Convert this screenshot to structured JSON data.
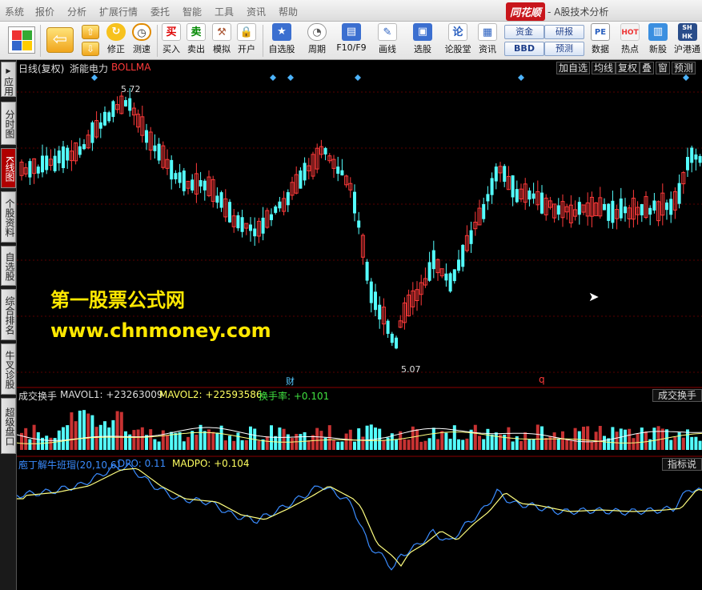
{
  "menubar": {
    "items": [
      "系统",
      "报价",
      "分析",
      "扩展行情",
      "委托",
      "智能",
      "工具",
      "资讯",
      "帮助"
    ],
    "brand": "同花顺",
    "subtitle": "- A股技术分析"
  },
  "toolbar": {
    "buttons": [
      {
        "label": "修正",
        "icon": "refresh-icon"
      },
      {
        "label": "测速",
        "icon": "clock-icon"
      },
      {
        "label": "买入",
        "icon": "buy-icon",
        "glyph": "买"
      },
      {
        "label": "卖出",
        "icon": "sell-icon",
        "glyph": "卖"
      },
      {
        "label": "模拟",
        "icon": "hammer-icon"
      },
      {
        "label": "开户",
        "icon": "lock-icon"
      },
      {
        "label": "自选股",
        "icon": "star-icon"
      },
      {
        "label": "周期",
        "icon": "period-icon"
      },
      {
        "label": "F10/F9",
        "icon": "f10-icon"
      },
      {
        "label": "画线",
        "icon": "pencil-icon"
      },
      {
        "label": "选股",
        "icon": "monitor-icon"
      },
      {
        "label": "论股堂",
        "icon": "discuss-icon"
      },
      {
        "label": "资讯",
        "icon": "news-icon"
      },
      {
        "label": "数据",
        "icon": "pe-icon"
      },
      {
        "label": "热点",
        "icon": "hot-icon"
      },
      {
        "label": "新股",
        "icon": "newstock-icon"
      },
      {
        "label": "沪港通",
        "icon": "shhk-icon"
      }
    ],
    "small_buttons": [
      "资金",
      "研报",
      "BBD",
      "预测"
    ]
  },
  "sidetabs": [
    "应用",
    "分时图",
    "K线图",
    "个股资料",
    "自选股",
    "综合排名",
    "牛叉诊股",
    "超级盘口"
  ],
  "main_chart": {
    "period": "日线(复权)",
    "stock": "浙能电力",
    "indicator": "BOLLMA",
    "buttons": [
      "加自选",
      "均线",
      "复权",
      "叠",
      "窗",
      "预测"
    ],
    "high_label": "5.72",
    "low_label": "5.07",
    "markers": [
      "财",
      "q"
    ]
  },
  "watermark": {
    "line1": "第一股票公式网",
    "line2": "www.chnmoney.com"
  },
  "volume_panel": {
    "title": "成交换手",
    "mavol1": "MAVOL1: +23263009",
    "mavol2": "MAVOL2: +22593586",
    "turnover": "换手率: +0.101",
    "right_label": "成交换手"
  },
  "dpo_panel": {
    "title": "庖丁解牛班瑁(20,10,6)",
    "dpo": "DPO: 0.11",
    "madpo": "MADPO: +0.104",
    "right_label": "指标说"
  },
  "colors": {
    "up": "#ff3a3a",
    "down": "#54ffff",
    "watermark": "#ffe800",
    "line_white": "#ffffff",
    "line_yellow": "#ffff80",
    "line_blue": "#3a8cff"
  }
}
